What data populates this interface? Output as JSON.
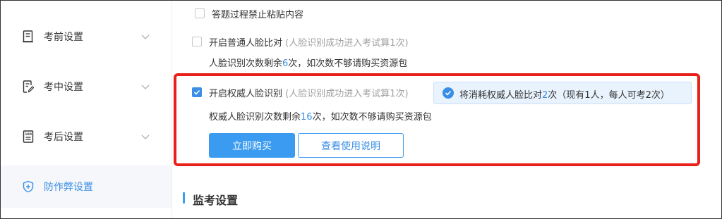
{
  "sidebar": {
    "items": [
      {
        "label": "考前设置",
        "icon": "document-icon"
      },
      {
        "label": "考中设置",
        "icon": "edit-document-icon"
      },
      {
        "label": "考后设置",
        "icon": "report-icon"
      },
      {
        "label": "防作弊设置",
        "icon": "shield-icon"
      }
    ]
  },
  "options": {
    "no_paste": {
      "label": "答题过程禁止粘贴内容",
      "checked": false
    },
    "normal_face": {
      "label": "开启普通人脸比对",
      "hint": "(人脸识别成功进入考试算1次)",
      "checked": false,
      "remain_prefix": "人脸识别次数剩余",
      "remain_count": "6",
      "remain_suffix": "次，如次数不够请购买资源包"
    },
    "authority_face": {
      "label": "开启权威人脸识别",
      "hint": "(人脸识别成功进入考试算1次)",
      "checked": true,
      "remain_prefix": "权威人脸识别次数剩余",
      "remain_count": "16",
      "remain_suffix": "次，如次数不够请购买资源包"
    }
  },
  "notice": {
    "prefix": "将消耗权威人脸比对",
    "count": "2",
    "suffix": "次（现有1人，每人可考2次）"
  },
  "buttons": {
    "buy": "立即购买",
    "manual": "查看使用说明"
  },
  "section": {
    "title": "监考设置"
  },
  "colors": {
    "accent": "#3a8ee6",
    "highlight": "#e8201a",
    "notice_bg": "#e9f3fd"
  }
}
